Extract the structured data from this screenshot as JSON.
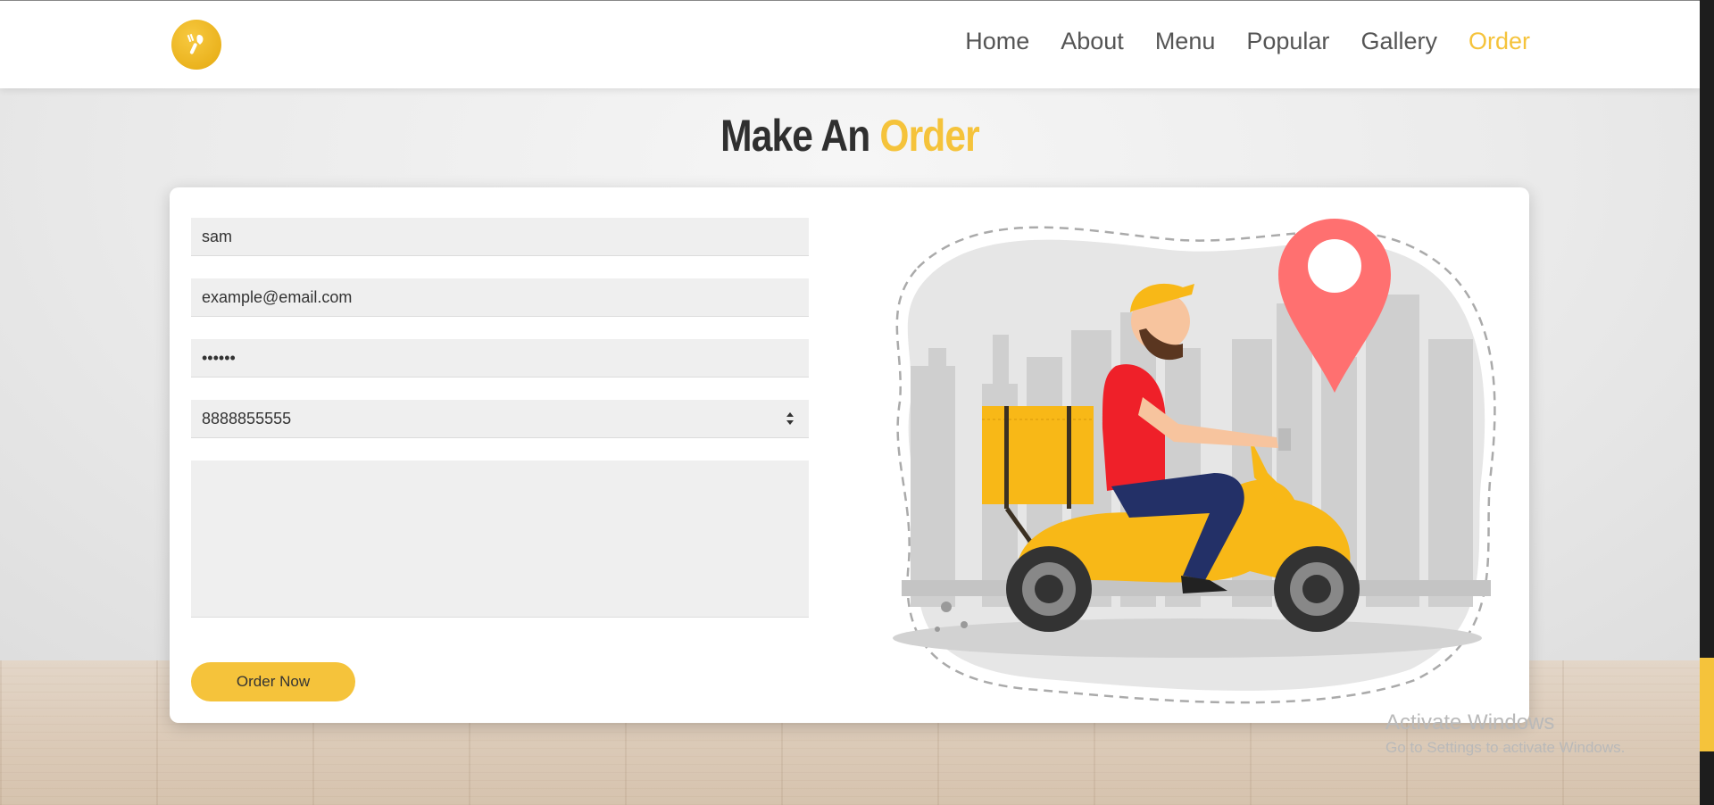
{
  "nav": {
    "items": [
      {
        "label": "Home",
        "active": false
      },
      {
        "label": "About",
        "active": false
      },
      {
        "label": "Menu",
        "active": false
      },
      {
        "label": "Popular",
        "active": false
      },
      {
        "label": "Gallery",
        "active": false
      },
      {
        "label": "Order",
        "active": true
      }
    ]
  },
  "logo": {
    "icon": "utensils-icon"
  },
  "heading": {
    "part1": "Make An",
    "part2": "Order"
  },
  "form": {
    "name_value": "sam",
    "email_value": "example@email.com",
    "password_value": "••••••",
    "phone_value": "8888855555",
    "message_value": "",
    "submit_label": "Order Now"
  },
  "illustration": {
    "name": "delivery-scooter-illustration"
  },
  "watermark": {
    "title": "Activate Windows",
    "subtitle": "Go to Settings to activate Windows."
  },
  "colors": {
    "accent": "#f5c33b",
    "text": "#2f2f2f",
    "pin": "#ff7070"
  }
}
